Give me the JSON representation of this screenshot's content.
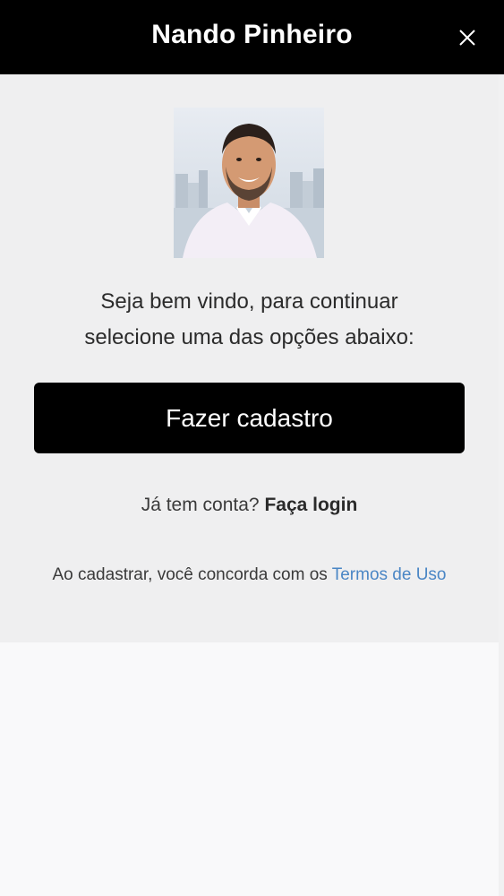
{
  "header": {
    "title": "Nando Pinheiro",
    "close_icon": "close-icon"
  },
  "main": {
    "welcome_line1": "Seja bem vindo, para continuar",
    "welcome_line2": "selecione uma das opções abaixo:",
    "signup_label": "Fazer cadastro",
    "login_prompt": "Já tem conta?",
    "login_label": "Faça login",
    "terms_prefix": "Ao cadastrar, você concorda com os",
    "terms_link": "Termos de Uso"
  },
  "colors": {
    "header_bg": "#000000",
    "button_bg": "#000000",
    "panel_bg": "#efeff0",
    "page_bg": "#f9f9fa",
    "link_color": "#4a86c5"
  }
}
